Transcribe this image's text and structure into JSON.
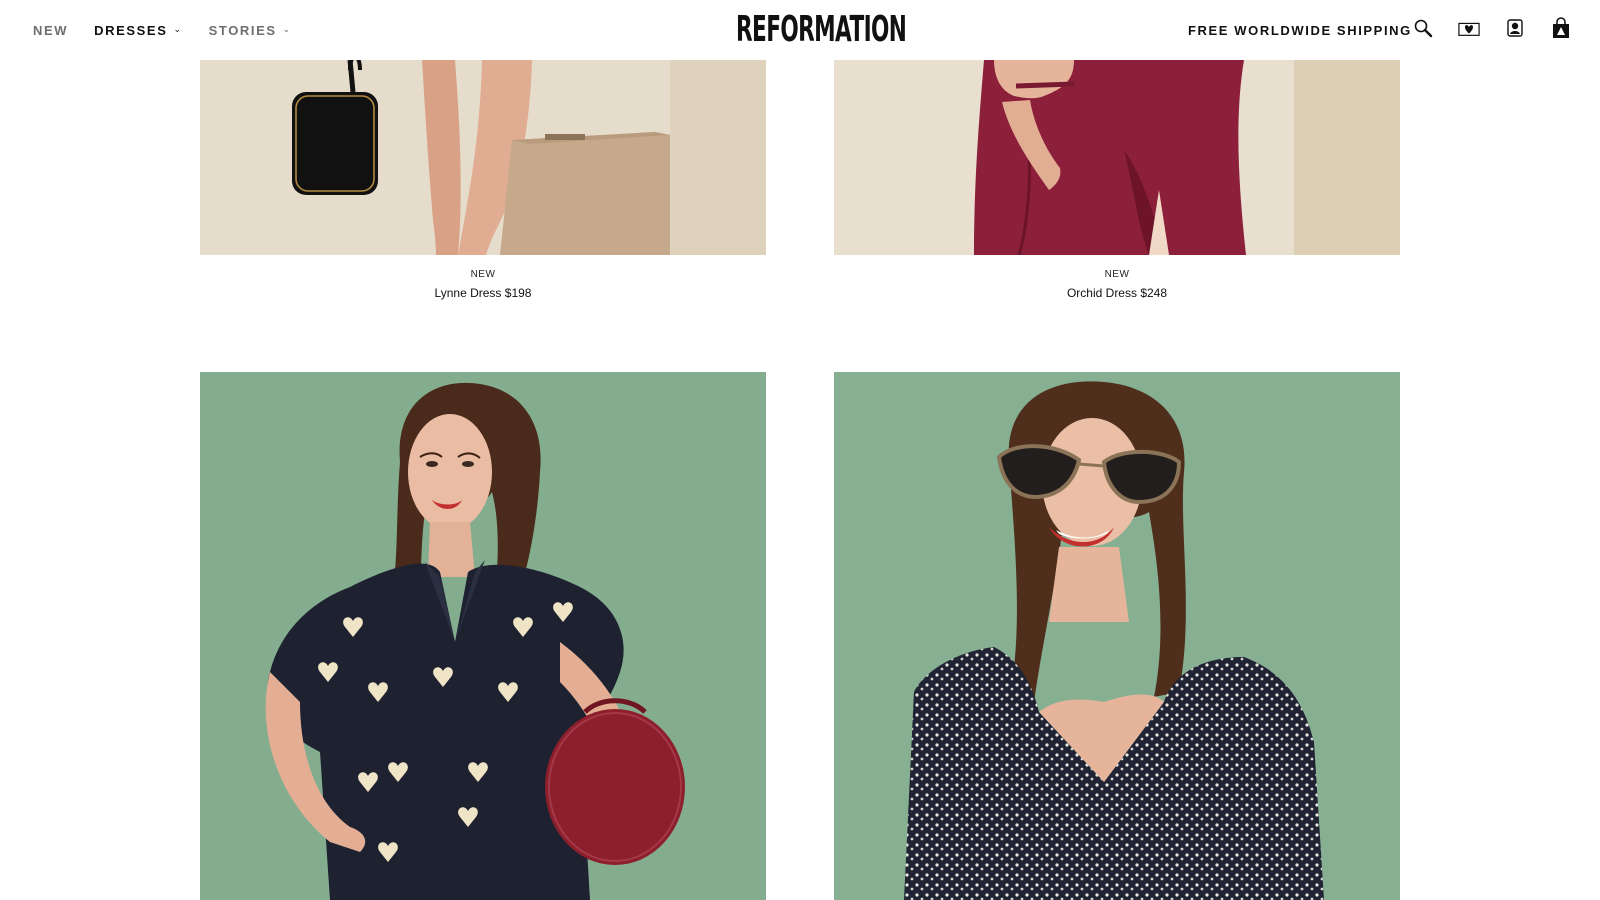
{
  "nav": {
    "items": [
      {
        "label": "NEW",
        "has_chevron": false,
        "active": false
      },
      {
        "label": "DRESSES",
        "has_chevron": true,
        "active": true
      },
      {
        "label": "STORIES",
        "has_chevron": true,
        "active": false
      }
    ]
  },
  "brand": {
    "logo": "REFORMATION"
  },
  "header": {
    "shipping": "FREE WORLDWIDE SHIPPING",
    "icons": [
      "search-icon",
      "wishlist-heart-icon",
      "account-icon",
      "shopping-bag-icon"
    ]
  },
  "products": [
    {
      "badge": "NEW",
      "title": "Lynne Dress $198",
      "image": "model-legs-with-black-handbag"
    },
    {
      "badge": "NEW",
      "title": "Orchid Dress $248",
      "image": "model-in-burgundy-dress"
    },
    {
      "badge": "",
      "title": "",
      "image": "model-in-navy-heart-print-dress-with-red-round-bag"
    },
    {
      "badge": "",
      "title": "",
      "image": "model-in-floral-dress-with-sunglasses"
    }
  ],
  "colors": {
    "accent": "#111111",
    "nav_inactive": "#6e6e6e",
    "photo_green": "#86ae90",
    "photo_beige": "#e4d9c6",
    "burgundy": "#8c1f3a"
  }
}
